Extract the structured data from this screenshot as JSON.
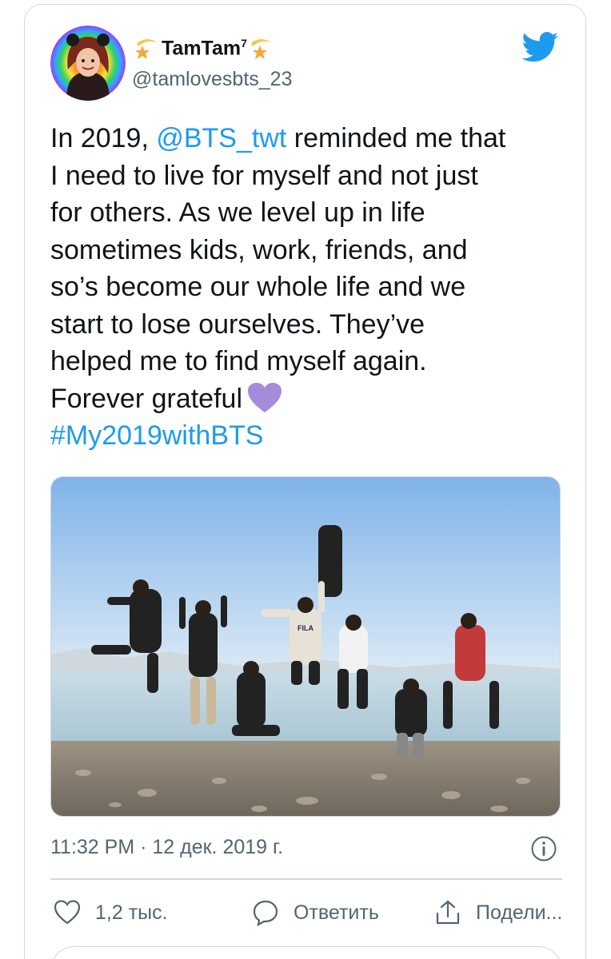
{
  "tweet": {
    "display_name": "TamTam",
    "display_name_sup": "7",
    "handle": "@tamlovesbts_23",
    "body_line1_prefix": "In 2019, ",
    "mention": "@BTS_twt",
    "body_line1_suffix": " reminded me that",
    "body_rest": "I need to live for myself and not just\nfor others. As we level up in life\nsometimes kids, work, friends, and\nso’s become our whole life and we\nstart to lose ourselves. They’ve\nhelped me to find myself again.\nForever grateful",
    "hashtag": "#My2019withBTS",
    "media_text": "FILA",
    "timestamp": "11:32 PM · 12 дек. 2019 г."
  },
  "actions": {
    "like_count": "1,2 тыс.",
    "reply_label": "Ответить",
    "share_label": "Подели..."
  },
  "icons": {
    "badge": "crescent-star-emoji",
    "bird": "twitter-bird-icon",
    "heart": "purple-heart-emoji",
    "info": "info-icon",
    "like": "heart-outline-icon",
    "reply": "reply-bubble-icon",
    "share": "share-upload-icon"
  },
  "colors": {
    "link": "#1d9bf0",
    "secondary_text": "#536471",
    "border": "#cfd9de",
    "purple_heart": "#a78bdb"
  }
}
